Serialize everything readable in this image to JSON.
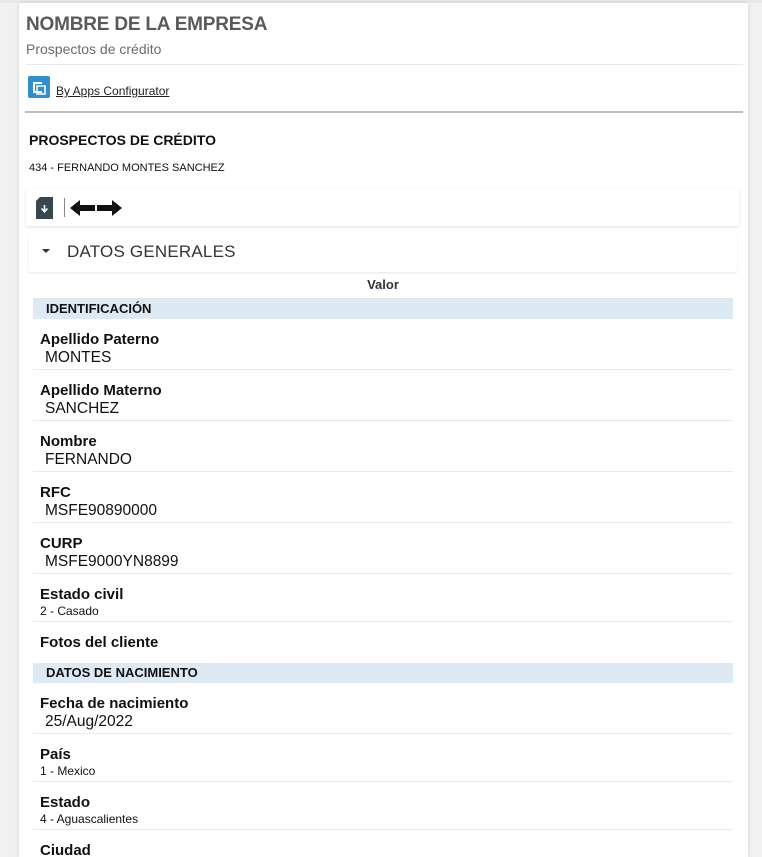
{
  "header": {
    "company": "NOMBRE DE LA EMPRESA",
    "subtitle": "Prospectos de crédito",
    "apps_link": "By Apps Configurator"
  },
  "main": {
    "title": "PROSPECTOS DE CRÉDITO",
    "record": "434 - FERNANDO MONTES SANCHEZ"
  },
  "toolbar": {
    "download_icon": "download-icon",
    "prev_icon": "arrow-left-icon",
    "next_icon": "arrow-right-icon"
  },
  "accordion": {
    "label": "DATOS GENERALES"
  },
  "table": {
    "column_header": "Valor",
    "groups": [
      {
        "title": "IDENTIFICACIÓN",
        "fields": [
          {
            "label": "Apellido Paterno",
            "value": "MONTES"
          },
          {
            "label": "Apellido Materno",
            "value": "SANCHEZ"
          },
          {
            "label": "Nombre",
            "value": "FERNANDO"
          },
          {
            "label": "RFC",
            "value": "MSFE90890000"
          },
          {
            "label": "CURP",
            "value": "MSFE9000YN8899"
          },
          {
            "label": "Estado civil",
            "value": "2 - Casado"
          },
          {
            "label": "Fotos del cliente",
            "value": ""
          }
        ]
      },
      {
        "title": "DATOS DE NACIMIENTO",
        "fields": [
          {
            "label": "Fecha de nacimiento",
            "value": "25/Aug/2022"
          },
          {
            "label": "País",
            "value": "1 - Mexico"
          },
          {
            "label": "Estado",
            "value": "4 - Aguascalientes"
          },
          {
            "label": "Ciudad",
            "value": ""
          }
        ]
      }
    ]
  },
  "colors": {
    "group_bg": "#dde9f3",
    "icon_blue": "#2f8fd0",
    "header_gray": "#5a5a5a"
  }
}
